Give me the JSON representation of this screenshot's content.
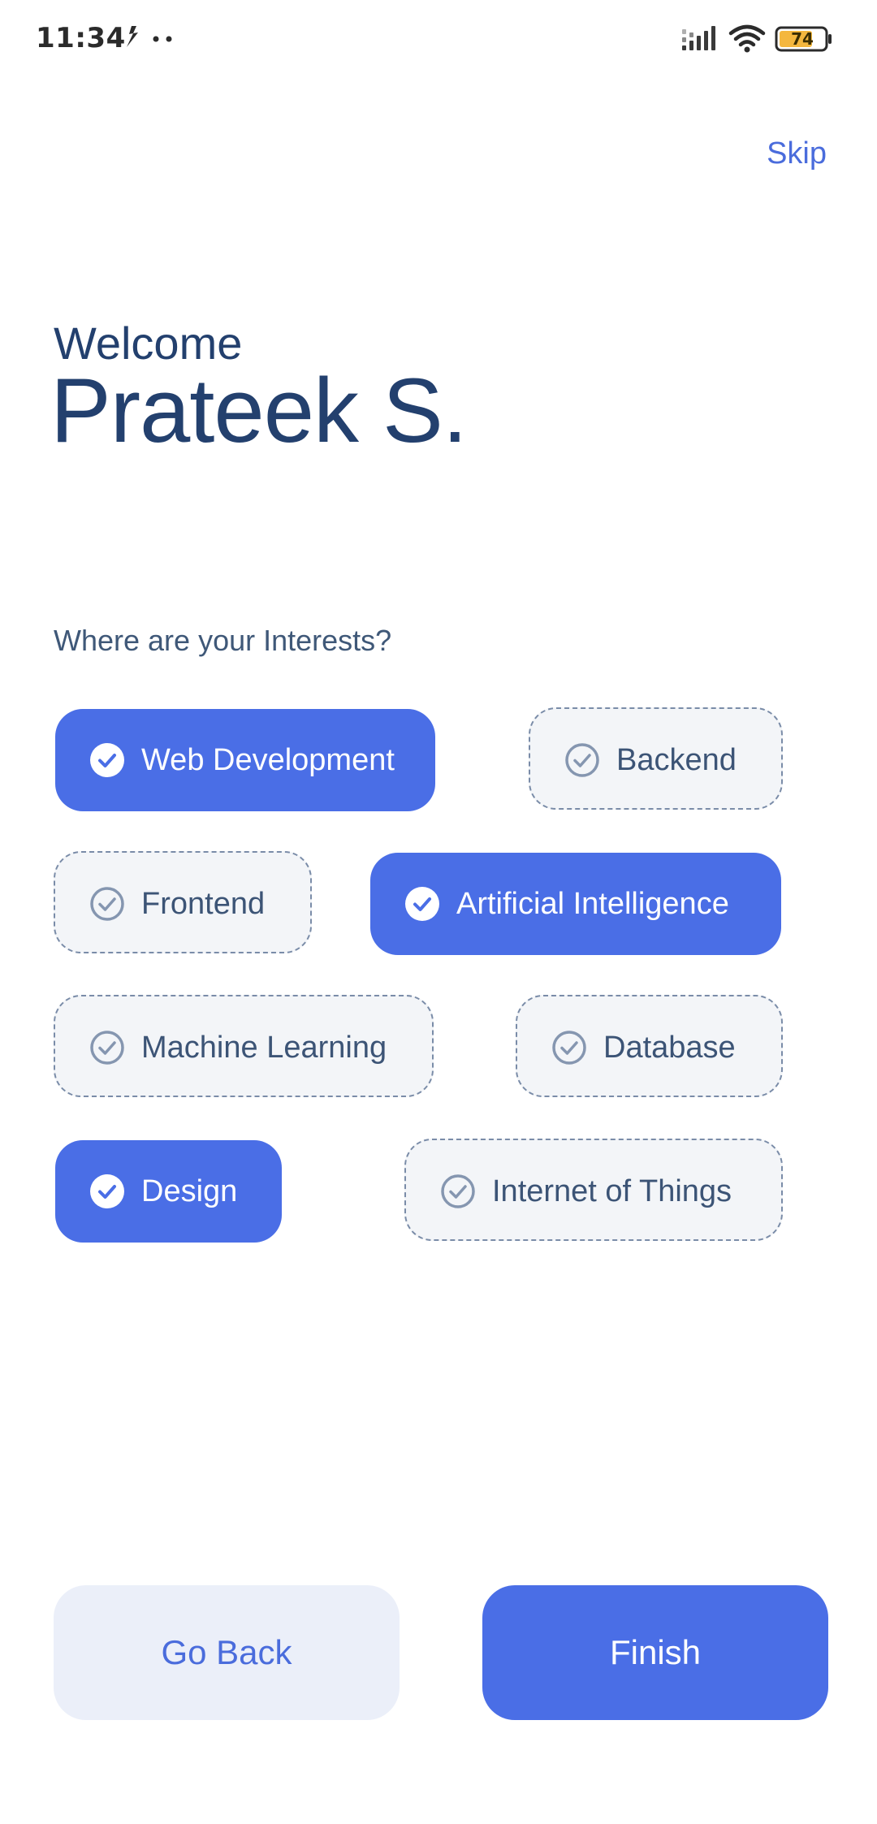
{
  "status_bar": {
    "time": "11:34",
    "battery_level": "74",
    "icons": [
      "notification-icon",
      "more-dots-icon",
      "signal-icon",
      "wifi-icon",
      "battery-icon"
    ],
    "battery_color": "#f4b73e"
  },
  "header": {
    "skip_label": "Skip"
  },
  "greeting": {
    "welcome": "Welcome",
    "name": "Prateek S."
  },
  "interests": {
    "question": "Where are your Interests?",
    "items": [
      {
        "label": "Web Development",
        "selected": true
      },
      {
        "label": "Backend",
        "selected": false
      },
      {
        "label": "Frontend",
        "selected": false
      },
      {
        "label": "Artificial Intelligence",
        "selected": true
      },
      {
        "label": "Machine Learning",
        "selected": false
      },
      {
        "label": "Database",
        "selected": false
      },
      {
        "label": "Design",
        "selected": true
      },
      {
        "label": "Internet of Things",
        "selected": false
      }
    ]
  },
  "actions": {
    "back_label": "Go Back",
    "finish_label": "Finish"
  },
  "colors": {
    "accent": "#4a6ee6",
    "heading": "#23406e",
    "chip_unselected_bg": "#f3f5f8",
    "chip_border": "#7a8ca8",
    "secondary_button_bg": "#ebeff9"
  }
}
